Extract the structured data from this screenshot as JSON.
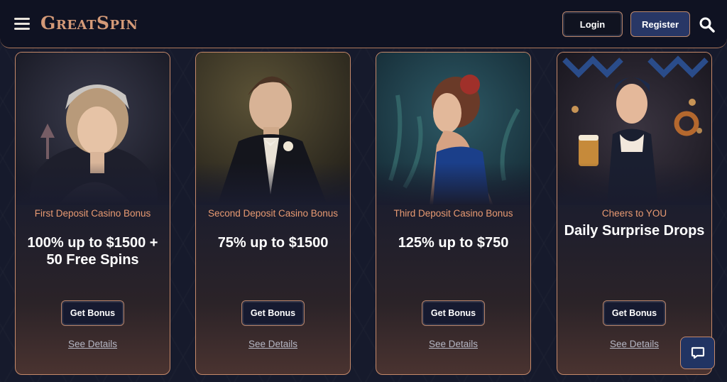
{
  "header": {
    "logo_text": "GreatSpin",
    "login_label": "Login",
    "register_label": "Register",
    "menu_icon": "hamburger-icon",
    "search_icon": "search-icon"
  },
  "cards": [
    {
      "subtitle": "First Deposit Casino Bonus",
      "title": "100% up to $1500 + 50 Free Spins",
      "button_label": "Get Bonus",
      "link_label": "See Details"
    },
    {
      "subtitle": "Second Deposit Casino Bonus",
      "title": "75% up to $1500",
      "button_label": "Get Bonus",
      "link_label": "See Details"
    },
    {
      "subtitle": "Third Deposit Casino Bonus",
      "title": "125% up to $750",
      "button_label": "Get Bonus",
      "link_label": "See Details"
    },
    {
      "subtitle": "Cheers to YOU",
      "title": "Daily Surprise Drops",
      "button_label": "Get Bonus",
      "link_label": "See Details"
    }
  ],
  "chat": {
    "icon": "chat-icon"
  },
  "colors": {
    "accent_copper": "#c5896a",
    "subtitle_orange": "#e89a72",
    "register_blue": "#283766",
    "background": "#161a2c"
  }
}
